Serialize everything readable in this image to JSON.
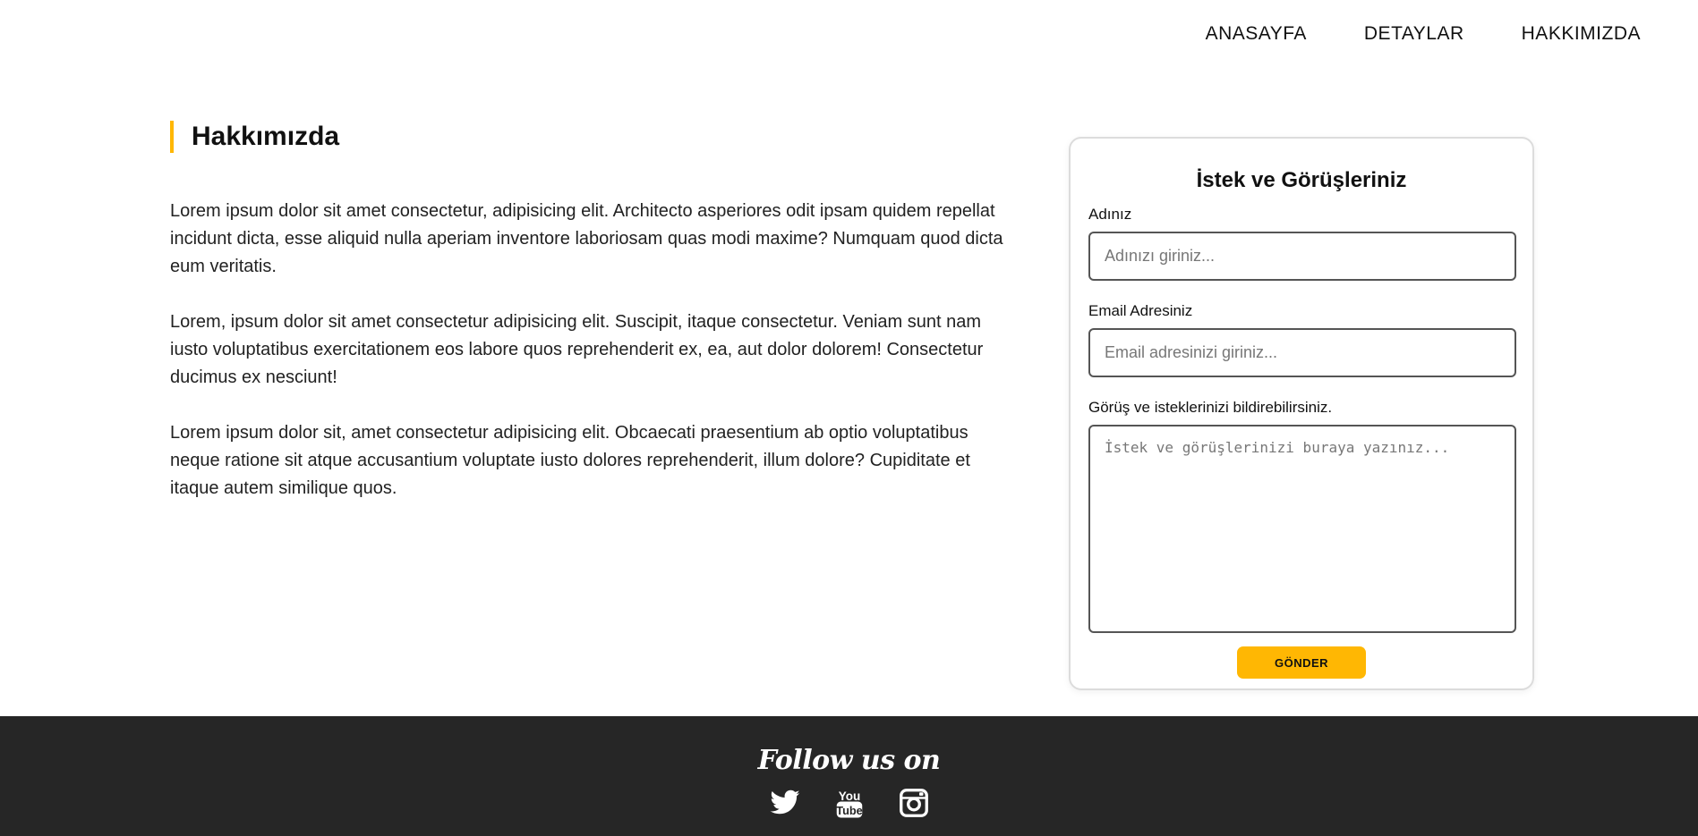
{
  "nav": {
    "items": [
      {
        "label": "ANASAYFA"
      },
      {
        "label": "DETAYLAR"
      },
      {
        "label": "HAKKIMIZDA"
      }
    ]
  },
  "about": {
    "title": "Hakkımızda",
    "paragraphs": [
      "Lorem ipsum dolor sit amet consectetur, adipisicing elit. Architecto asperiores odit ipsam quidem repellat incidunt dicta, esse aliquid nulla aperiam inventore laboriosam quas modi maxime? Numquam quod dicta eum veritatis.",
      "Lorem, ipsum dolor sit amet consectetur adipisicing elit. Suscipit, itaque consectetur. Veniam sunt nam iusto voluptatibus exercitationem eos labore quos reprehenderit ex, ea, aut dolor dolorem! Consectetur ducimus ex nesciunt!",
      "Lorem ipsum dolor sit, amet consectetur adipisicing elit. Obcaecati praesentium ab optio voluptatibus neque ratione sit atque accusantium voluptate iusto dolores reprehenderit, illum dolore? Cupiditate et itaque autem similique quos."
    ]
  },
  "form": {
    "title": "İstek ve Görüşleriniz",
    "name_label": "Adınız",
    "name_placeholder": "Adınızı giriniz...",
    "name_value": "",
    "email_label": "Email Adresiniz",
    "email_placeholder": "Email adresinizi giriniz...",
    "email_value": "",
    "message_label": "Görüş ve isteklerinizi bildirebilirsiniz.",
    "message_placeholder": "İstek ve görüşlerinizi buraya yazınız...",
    "message_value": "",
    "submit_label": "GÖNDER"
  },
  "footer": {
    "title": "Follow us on",
    "social": [
      {
        "icon": "twitter-icon"
      },
      {
        "icon": "youtube-icon"
      },
      {
        "icon": "instagram-icon"
      }
    ]
  },
  "colors": {
    "accent": "#ffb703",
    "footer_bg": "#262626",
    "text": "#1f1f1f"
  }
}
